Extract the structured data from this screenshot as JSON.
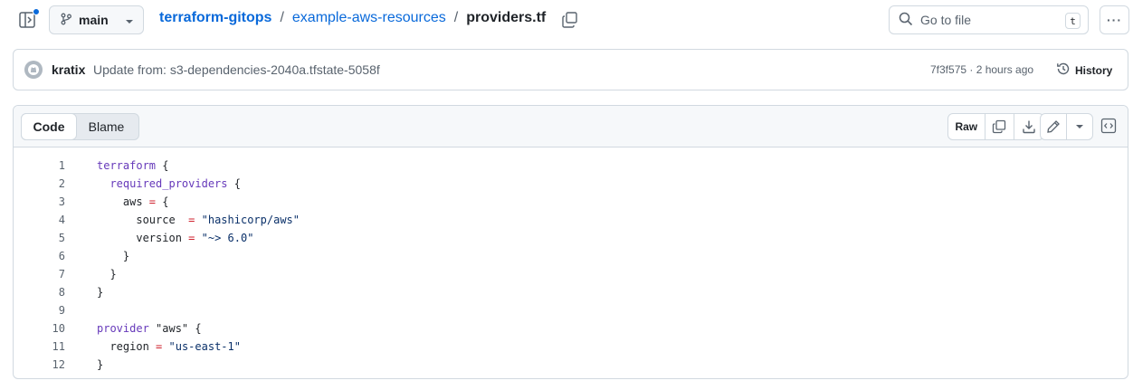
{
  "header": {
    "branch": "main",
    "repo": "terraform-gitops",
    "directory": "example-aws-resources",
    "separator": "/",
    "file": "providers.tf",
    "goto_placeholder": "Go to file",
    "goto_shortcut": "t",
    "more_label": "···"
  },
  "commit": {
    "author": "kratix",
    "message": "Update from: s3-dependencies-2040a.tfstate-5058f",
    "meta": "7f3f575 · 2 hours ago",
    "history_label": "History"
  },
  "file_view": {
    "tabs": [
      "Code",
      "Blame"
    ],
    "active_tab": "Code",
    "raw_label": "Raw",
    "lines": [
      {
        "n": "1",
        "tokens": [
          {
            "t": "terraform",
            "k": "kw"
          },
          {
            "t": " {",
            "k": "pl"
          }
        ]
      },
      {
        "n": "2",
        "tokens": [
          {
            "t": "  ",
            "k": "pl"
          },
          {
            "t": "required_providers",
            "k": "kw"
          },
          {
            "t": " {",
            "k": "pl"
          }
        ]
      },
      {
        "n": "3",
        "tokens": [
          {
            "t": "    aws ",
            "k": "pl"
          },
          {
            "t": "=",
            "k": "op"
          },
          {
            "t": " {",
            "k": "pl"
          }
        ]
      },
      {
        "n": "4",
        "tokens": [
          {
            "t": "      source  ",
            "k": "pl"
          },
          {
            "t": "=",
            "k": "op"
          },
          {
            "t": " ",
            "k": "pl"
          },
          {
            "t": "\"hashicorp/aws\"",
            "k": "str"
          }
        ]
      },
      {
        "n": "5",
        "tokens": [
          {
            "t": "      version ",
            "k": "pl"
          },
          {
            "t": "=",
            "k": "op"
          },
          {
            "t": " ",
            "k": "pl"
          },
          {
            "t": "\"~> 6.0\"",
            "k": "str"
          }
        ]
      },
      {
        "n": "6",
        "tokens": [
          {
            "t": "    }",
            "k": "pl"
          }
        ]
      },
      {
        "n": "7",
        "tokens": [
          {
            "t": "  }",
            "k": "pl"
          }
        ]
      },
      {
        "n": "8",
        "tokens": [
          {
            "t": "}",
            "k": "pl"
          }
        ]
      },
      {
        "n": "9",
        "tokens": []
      },
      {
        "n": "10",
        "tokens": [
          {
            "t": "provider",
            "k": "kw"
          },
          {
            "t": " \"aws\" {",
            "k": "pl"
          }
        ]
      },
      {
        "n": "11",
        "tokens": [
          {
            "t": "  region ",
            "k": "pl"
          },
          {
            "t": "=",
            "k": "op"
          },
          {
            "t": " ",
            "k": "pl"
          },
          {
            "t": "\"us-east-1\"",
            "k": "str"
          }
        ]
      },
      {
        "n": "12",
        "tokens": [
          {
            "t": "}",
            "k": "pl"
          }
        ]
      }
    ]
  },
  "colors": {
    "link": "#0969da",
    "keyword": "#6639ba",
    "operator": "#cf222e",
    "string": "#0a3069",
    "border": "#d1d9e0",
    "muted": "#59636e"
  },
  "icons": [
    "sidebar-toggle-icon",
    "git-branch-icon",
    "chevron-down-icon",
    "copy-icon",
    "search-icon",
    "kebab-horizontal-icon",
    "github-avatar-icon",
    "history-icon",
    "download-icon",
    "pencil-icon",
    "code-symbols-icon"
  ]
}
